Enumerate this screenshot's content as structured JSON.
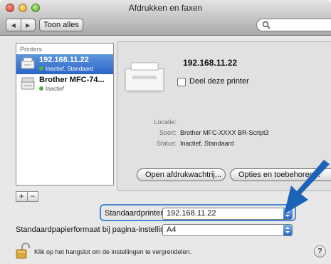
{
  "window": {
    "title": "Afdrukken en faxen"
  },
  "toolbar": {
    "back_glyph": "◀",
    "forward_glyph": "▶",
    "show_all_label": "Toon alles",
    "search_value": ""
  },
  "printer_list": {
    "header": "Printers",
    "items": [
      {
        "name": "192.168.11.22",
        "status": "Inactief, Standaard",
        "selected": true
      },
      {
        "name": "Brother MFC-74...",
        "status": "Inactief",
        "selected": false
      }
    ],
    "add_label": "+",
    "remove_label": "−"
  },
  "details": {
    "name": "192.168.11.22",
    "share_label": "Deel deze printer",
    "share_checked": false,
    "location_key": "Locatie:",
    "location_value": "",
    "kind_key": "Soort:",
    "kind_value": "Brother MFC-XXXX BR-Script3",
    "status_key": "Status:",
    "status_value": "Inactief, Standaard",
    "queue_button": "Open afdrukwachtrij...",
    "options_button": "Opties en toebehoren..."
  },
  "defaults": {
    "printer_label": "Standaardprinter:",
    "printer_value": "192.168.11.22",
    "paper_label": "Standaardpapierformaat bij pagina-instelling:",
    "paper_value": "A4"
  },
  "footer": {
    "lock_text": "Klik op het hangslot om de instellingen te vergrendelen.",
    "help_glyph": "?"
  },
  "colors": {
    "selection": "#2a65c7",
    "arrow": "#1d63b8",
    "status_dot": "#4bb43b"
  }
}
